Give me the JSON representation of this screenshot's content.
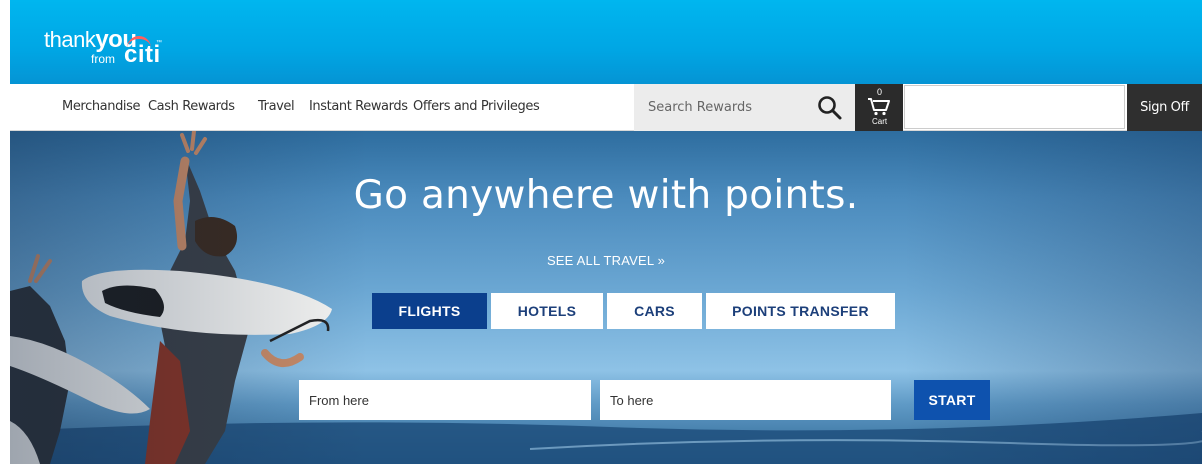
{
  "brand": {
    "thank": "thank",
    "you": "you",
    "from": "from",
    "citi": "citi",
    "tm": "™"
  },
  "nav": {
    "items": [
      {
        "label": "Merchandise"
      },
      {
        "label": "Cash Rewards"
      },
      {
        "label": "Travel"
      },
      {
        "label": "Instant Rewards"
      },
      {
        "label": "Offers and Privileges"
      }
    ]
  },
  "search": {
    "placeholder": "Search Rewards",
    "icon": "search-icon"
  },
  "cart": {
    "count": "0",
    "label": "Cart",
    "icon": "cart-icon"
  },
  "account": {
    "sign_off_label": "Sign Off"
  },
  "hero": {
    "title": "Go anywhere with points.",
    "see_all_link": "SEE ALL TRAVEL »",
    "tabs": [
      {
        "label": "FLIGHTS",
        "active": true
      },
      {
        "label": "HOTELS",
        "active": false
      },
      {
        "label": "CARS",
        "active": false
      },
      {
        "label": "POINTS TRANSFER",
        "active": false
      }
    ],
    "from_placeholder": "From here",
    "to_placeholder": "To here",
    "start_label": "START"
  },
  "colors": {
    "banner_blue": "#00a6e4",
    "tab_active": "#0b3f8d",
    "start_button": "#0e52ae",
    "dark_button": "#2f2f2f"
  }
}
